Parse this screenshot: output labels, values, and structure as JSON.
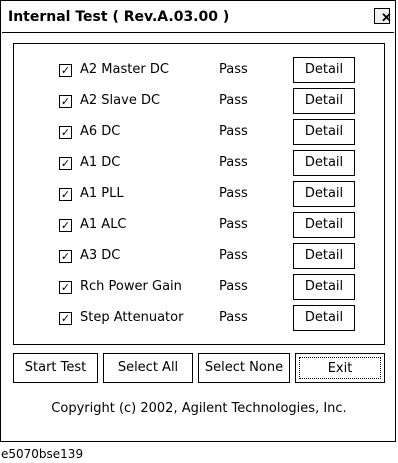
{
  "window": {
    "title": "Internal Test ( Rev.A.03.00 )",
    "close_glyph": "✕"
  },
  "tests": [
    {
      "name": "A2 Master DC",
      "checked": true,
      "status": "Pass",
      "detail_label": "Detail"
    },
    {
      "name": "A2 Slave DC",
      "checked": true,
      "status": "Pass",
      "detail_label": "Detail"
    },
    {
      "name": "A6 DC",
      "checked": true,
      "status": "Pass",
      "detail_label": "Detail"
    },
    {
      "name": "A1 DC",
      "checked": true,
      "status": "Pass",
      "detail_label": "Detail"
    },
    {
      "name": "A1 PLL",
      "checked": true,
      "status": "Pass",
      "detail_label": "Detail"
    },
    {
      "name": "A1 ALC",
      "checked": true,
      "status": "Pass",
      "detail_label": "Detail"
    },
    {
      "name": "A3 DC",
      "checked": true,
      "status": "Pass",
      "detail_label": "Detail"
    },
    {
      "name": "Rch Power Gain",
      "checked": true,
      "status": "Pass",
      "detail_label": "Detail"
    },
    {
      "name": "Step Attenuator",
      "checked": true,
      "status": "Pass",
      "detail_label": "Detail"
    }
  ],
  "buttons": {
    "start_test": "Start Test",
    "select_all": "Select All",
    "select_none": "Select None",
    "exit": "Exit"
  },
  "copyright": "Copyright (c) 2002, Agilent Technologies, Inc.",
  "caption": "e5070bse139",
  "check_glyph": "✓"
}
